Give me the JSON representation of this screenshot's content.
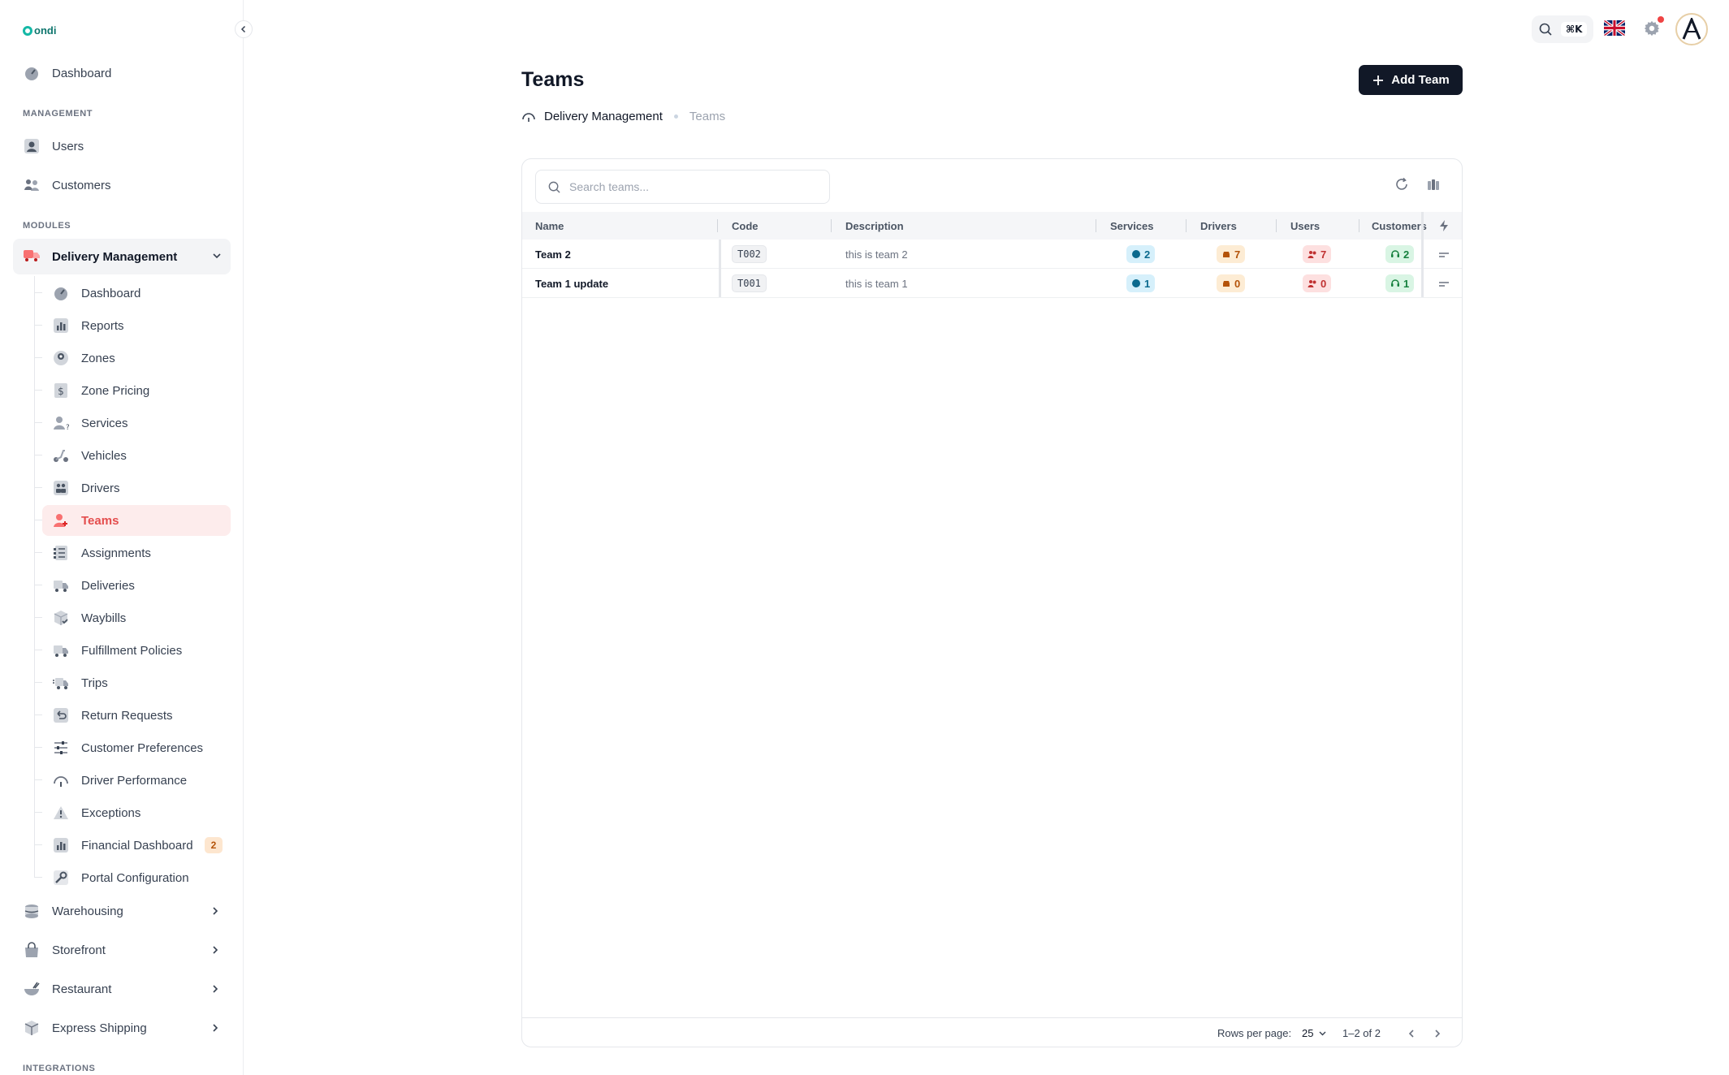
{
  "brand": {
    "logo_text": "ondi"
  },
  "sidebar": {
    "dashboard": "Dashboard",
    "management_label": "MANAGEMENT",
    "users": "Users",
    "customers": "Customers",
    "modules_label": "MODULES",
    "delivery_management": "Delivery Management",
    "sub_items": [
      {
        "label": "Dashboard",
        "icon": "gauge-icon"
      },
      {
        "label": "Reports",
        "icon": "chart-icon"
      },
      {
        "label": "Zones",
        "icon": "map-pin-icon"
      },
      {
        "label": "Zone Pricing",
        "icon": "dollar-tag-icon"
      },
      {
        "label": "Services",
        "icon": "person-help-icon"
      },
      {
        "label": "Vehicles",
        "icon": "scooter-icon"
      },
      {
        "label": "Drivers",
        "icon": "id-card-icon"
      },
      {
        "label": "Teams",
        "icon": "team-icon"
      },
      {
        "label": "Assignments",
        "icon": "clipboard-list-icon"
      },
      {
        "label": "Deliveries",
        "icon": "truck-icon"
      },
      {
        "label": "Waybills",
        "icon": "box-check-icon"
      },
      {
        "label": "Fulfillment Policies",
        "icon": "truck-policy-icon"
      },
      {
        "label": "Trips",
        "icon": "truck-fast-icon"
      },
      {
        "label": "Return Requests",
        "icon": "return-box-icon"
      },
      {
        "label": "Customer Preferences",
        "icon": "sliders-icon"
      },
      {
        "label": "Driver Performance",
        "icon": "speedometer-icon"
      },
      {
        "label": "Exceptions",
        "icon": "warning-icon"
      },
      {
        "label": "Financial Dashboard",
        "icon": "finance-chart-icon",
        "badge": "2"
      },
      {
        "label": "Portal Configuration",
        "icon": "wrench-icon"
      }
    ],
    "warehousing": "Warehousing",
    "storefront": "Storefront",
    "restaurant": "Restaurant",
    "express_shipping": "Express Shipping",
    "integrations_label": "INTEGRATIONS"
  },
  "topbar": {
    "shortcut": "⌘K"
  },
  "page": {
    "title": "Teams",
    "add_button": "Add Team",
    "breadcrumb": [
      "Delivery Management",
      "Teams"
    ]
  },
  "table": {
    "search_placeholder": "Search teams...",
    "columns": [
      "Name",
      "Code",
      "Description",
      "Services",
      "Drivers",
      "Users",
      "Customers"
    ],
    "rows": [
      {
        "name": "Team 2",
        "code": "T002",
        "description": "this is team 2",
        "services": "2",
        "drivers": "7",
        "users": "7",
        "customers": "2"
      },
      {
        "name": "Team 1 update",
        "code": "T001",
        "description": "this is team 1",
        "services": "1",
        "drivers": "0",
        "users": "0",
        "customers": "1"
      }
    ],
    "pagination": {
      "rows_per_page_label": "Rows per page:",
      "rows_per_page": "25",
      "range": "1–2 of 2"
    }
  },
  "colors": {
    "accent_active": "#e44d4d",
    "primary_button": "#111827",
    "brand": "#14b8a6"
  }
}
